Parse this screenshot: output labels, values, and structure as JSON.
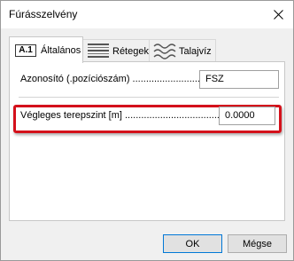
{
  "window": {
    "title": "Fúrásszelvény"
  },
  "tabs": [
    {
      "icon_text": "A.1",
      "label": "Általános",
      "active": true
    },
    {
      "icon": "layers-icon",
      "label": "Rétegek",
      "active": false
    },
    {
      "icon": "waves-icon",
      "label": "Talajvíz",
      "active": false
    }
  ],
  "fields": {
    "id": {
      "label": "Azonosító (.pozíciószám) .........................",
      "value": "FSZ"
    },
    "final_level": {
      "label": "Végleges terepszint [m] .......................................",
      "value": "0.0000"
    }
  },
  "buttons": {
    "ok": "OK",
    "cancel": "Mégse"
  },
  "colors": {
    "highlight": "#d4111b",
    "accent": "#0078d7"
  }
}
